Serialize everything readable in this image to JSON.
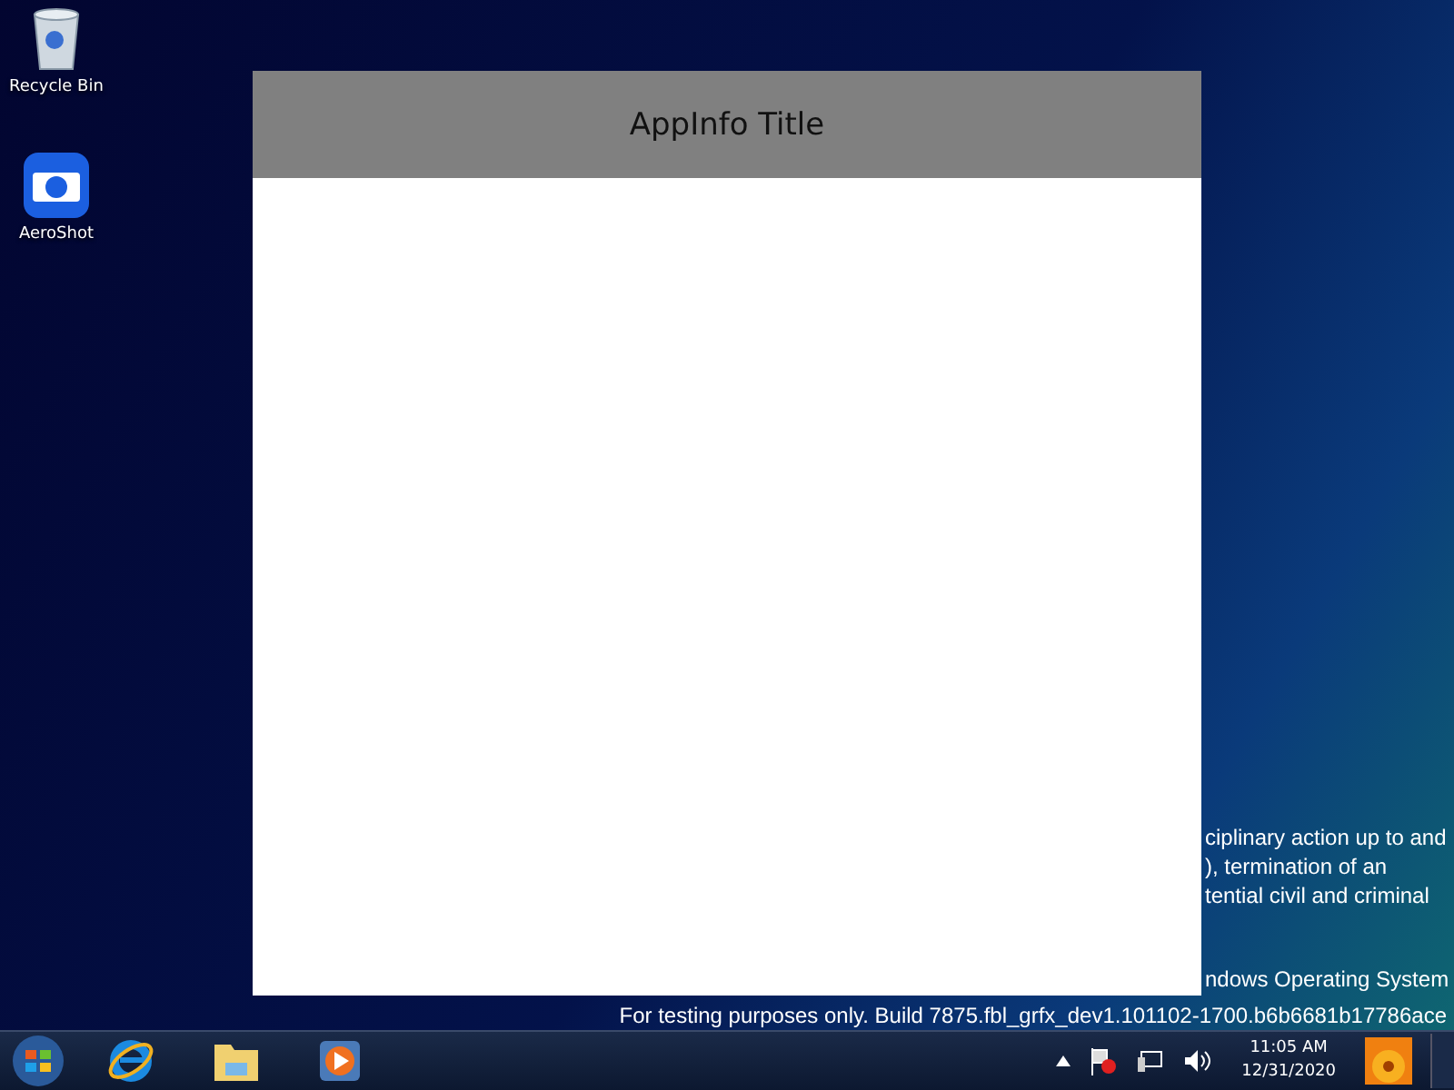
{
  "desktop_icons": [
    {
      "label": "Recycle Bin",
      "kind": "bin"
    },
    {
      "label": "AeroShot",
      "kind": "camera"
    }
  ],
  "window": {
    "title": "AppInfo Title"
  },
  "watermark": {
    "lines": [
      "ciplinary action up to and",
      "), termination of an",
      "tential civil and criminal"
    ],
    "os_line": "ndows Operating System",
    "build_line": "For testing purposes only. Build 7875.fbl_grfx_dev1.101102-1700.b6b6681b17786ace"
  },
  "taskbar": {
    "time": "11:05 AM",
    "date": "12/31/2020"
  }
}
